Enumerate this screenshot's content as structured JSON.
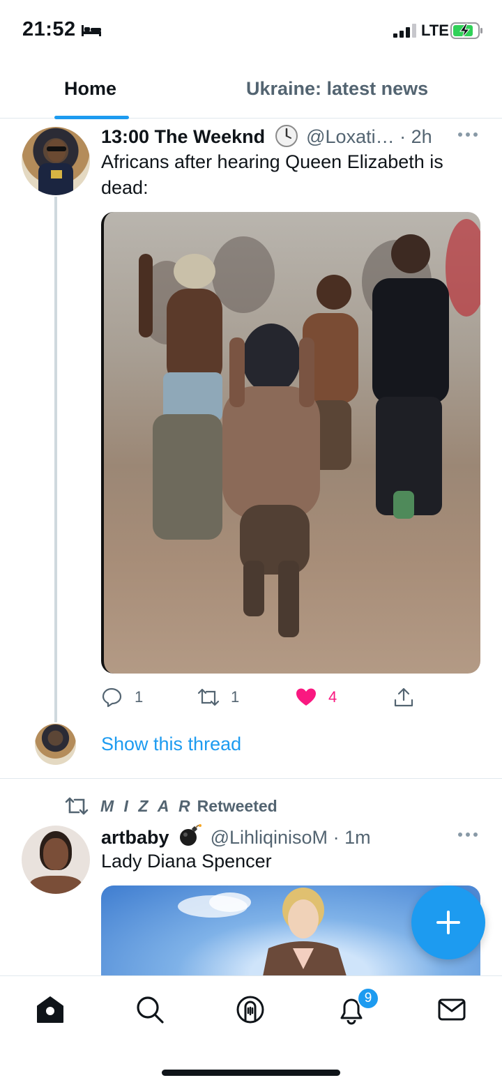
{
  "status_bar": {
    "time": "21:52",
    "network": "LTE",
    "icons": [
      "bed-icon",
      "signal-icon",
      "battery-charging-icon"
    ]
  },
  "tabs": [
    {
      "label": "Home",
      "active": true
    },
    {
      "label": "Ukraine: latest news",
      "active": false
    }
  ],
  "colors": {
    "accent": "#1d9bf0",
    "like": "#f91880",
    "secondary_text": "#536471"
  },
  "tweet1": {
    "display_name": "13:00 The Weeknd",
    "name_emoji": "clock-icon",
    "handle": "@Loxati…",
    "time": "· 2h",
    "text": "Africans after hearing Queen Elizabeth is dead:",
    "replies": "1",
    "retweets": "1",
    "likes": "4",
    "liked": true,
    "show_thread": "Show this thread"
  },
  "tweet2": {
    "retweeted_by": "M I Z A R",
    "retweeted_label": "Retweeted",
    "display_name": "artbaby",
    "name_emoji": "bomb-icon",
    "handle": "@LihliqinisoM",
    "time": "· 1m",
    "text": "Lady Diana Spencer"
  },
  "bottom_nav": {
    "items": [
      "home-icon",
      "search-icon",
      "spaces-icon",
      "notifications-icon",
      "messages-icon"
    ],
    "notification_count": "9"
  }
}
